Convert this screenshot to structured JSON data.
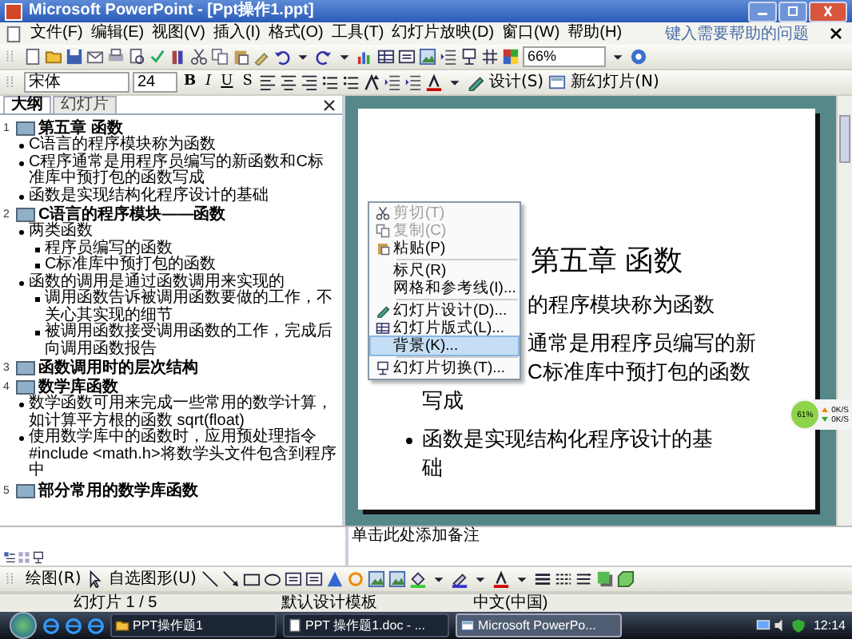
{
  "window": {
    "title": "Microsoft PowerPoint - [Ppt操作1.ppt]"
  },
  "menu_bar": {
    "items": [
      {
        "label": "文件(F)"
      },
      {
        "label": "编辑(E)"
      },
      {
        "label": "视图(V)"
      },
      {
        "label": "插入(I)"
      },
      {
        "label": "格式(O)"
      },
      {
        "label": "工具(T)"
      },
      {
        "label": "幻灯片放映(D)"
      },
      {
        "label": "窗口(W)"
      },
      {
        "label": "帮助(H)"
      }
    ],
    "help_placeholder": "键入需要帮助的问题"
  },
  "standard_toolbar": {
    "zoom": "66%"
  },
  "format_toolbar": {
    "font": "宋体",
    "size": "24",
    "style_buttons": [
      "B",
      "I",
      "U",
      "S"
    ],
    "text_buttons": [
      "设计(S)",
      "新幻灯片(N)"
    ]
  },
  "outline_pane": {
    "tabs": [
      {
        "label": "大纲",
        "selected": true
      },
      {
        "label": "幻灯片",
        "selected": false
      }
    ],
    "slides": [
      {
        "number": "1",
        "title": "第五章 函数",
        "children": [
          {
            "text": "C语言的程序模块称为函数"
          },
          {
            "text": "C程序通常是用程序员编写的新函数和C标准库中预打包的函数写成"
          },
          {
            "text": "函数是实现结构化程序设计的基础"
          }
        ]
      },
      {
        "number": "2",
        "title": "C语言的程序模块——函数",
        "children": [
          {
            "text": "两类函数",
            "children": [
              {
                "text": "程序员编写的函数"
              },
              {
                "text": "C标准库中预打包的函数"
              }
            ]
          },
          {
            "text": "函数的调用是通过函数调用来实现的",
            "children": [
              {
                "text": "调用函数告诉被调用函数要做的工作，不关心其实现的细节"
              },
              {
                "text": "被调用函数接受调用函数的工作，完成后向调用函数报告"
              }
            ]
          }
        ]
      },
      {
        "number": "3",
        "title": "函数调用时的层次结构"
      },
      {
        "number": "4",
        "title": "数学库函数",
        "children": [
          {
            "text": "数学函数可用来完成一些常用的数学计算，如计算平方根的函数 sqrt(float)"
          },
          {
            "text": "使用数学库中的函数时，应用预处理指令 #include <math.h>将数学头文件包含到程序中"
          }
        ]
      },
      {
        "number": "5",
        "title": "部分常用的数学库函数"
      }
    ]
  },
  "slide": {
    "title": "第五章 函数",
    "bullets": [
      {
        "covered": true,
        "lines": [
          {
            "text": "的程序模块称为函数",
            "covered": true
          }
        ]
      },
      {
        "covered": true,
        "lines": [
          {
            "text": "通常是用程序员编写的新",
            "covered": true
          },
          {
            "text": "C标准库中预打包的函数",
            "covered": true
          },
          {
            "text": "写成",
            "covered": false
          }
        ]
      },
      {
        "covered": false,
        "lines": [
          {
            "text": "函数是实现结构化程序设计的基",
            "covered": false
          },
          {
            "text": "础",
            "covered": false
          }
        ]
      }
    ]
  },
  "context_menu": {
    "items": [
      {
        "kind": "item",
        "label": "剪切(T)",
        "disabled": true,
        "selected": false
      },
      {
        "kind": "item",
        "label": "复制(C)",
        "disabled": true,
        "selected": false
      },
      {
        "kind": "item",
        "label": "粘贴(P)",
        "disabled": false,
        "selected": false
      },
      {
        "kind": "separator"
      },
      {
        "kind": "item",
        "label": "标尺(R)",
        "disabled": false,
        "selected": false
      },
      {
        "kind": "item",
        "label": "网格和参考线(I)...",
        "disabled": false,
        "selected": false
      },
      {
        "kind": "separator"
      },
      {
        "kind": "item",
        "label": "幻灯片设计(D)...",
        "disabled": false,
        "selected": false
      },
      {
        "kind": "item",
        "label": "幻灯片版式(L)...",
        "disabled": false,
        "selected": false
      },
      {
        "kind": "item",
        "label": "背景(K)...",
        "disabled": false,
        "selected": true
      },
      {
        "kind": "separator"
      },
      {
        "kind": "item",
        "label": "幻灯片切换(T)...",
        "disabled": false,
        "selected": false
      }
    ]
  },
  "network_meter": {
    "percent": "61%",
    "upload": "0K/S",
    "download": "0K/S"
  },
  "notes": {
    "text": "单击此处添加备注"
  },
  "drawing_toolbar": {
    "buttons": [
      "绘图(R)",
      "自选图形(U)"
    ]
  },
  "status_bar": [
    "幻灯片 1 / 5",
    "默认设计模板",
    "中文(中国)"
  ],
  "taskbar": {
    "tasks": [
      {
        "label": "PPT操作题1",
        "selected": false
      },
      {
        "label": "PPT 操作题1.doc - ...",
        "selected": false
      },
      {
        "label": "Microsoft PowerPo...",
        "selected": true
      }
    ],
    "clock": "12:14"
  }
}
